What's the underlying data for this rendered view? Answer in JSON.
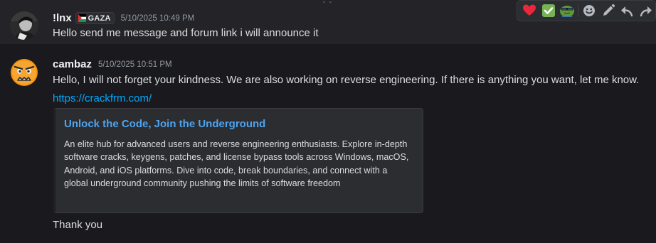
{
  "messages": [
    {
      "username": "!lnx",
      "tag": {
        "label": "GAZA"
      },
      "timestamp": "5/10/2025 10:49 PM",
      "text": "Hello send me message and forum link i will announce it"
    },
    {
      "username": "cambaz",
      "timestamp": "5/10/2025 10:51 PM",
      "text": "Hello, I will not forget your kindness. We are also working on reverse engineering. If there is anything you want, let me know.",
      "link": "https://crackfrm.com/",
      "embed": {
        "title": "Unlock the Code, Join the Underground",
        "description": "An elite hub for advanced users and reverse engineering enthusiasts. Explore in-depth software cracks, keygens, patches, and license bypass tools across Windows, macOS, Android, and iOS platforms. Dive into code, break boundaries, and connect with a global underground community pushing the limits of software freedom"
      },
      "followup": "Thank you"
    }
  ],
  "toolbar": {
    "icons": [
      "heart-icon",
      "check-mark-icon",
      "pepe-emoji-icon",
      "add-reaction-icon",
      "edit-icon",
      "reply-icon",
      "forward-icon"
    ]
  },
  "colors": {
    "background": "#1a1a1e",
    "hover_row": "#232328",
    "link": "#00a8fc",
    "embed_title": "#4ea4ee",
    "timestamp": "#949ba4"
  }
}
